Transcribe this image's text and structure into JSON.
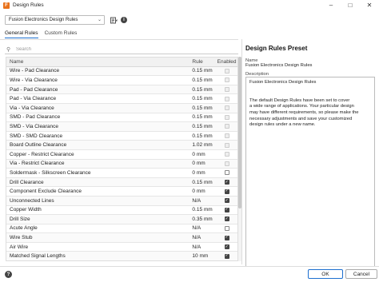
{
  "window": {
    "title": "Design Rules",
    "app_icon": "fusion-app-icon",
    "controls": [
      "minimize",
      "maximize",
      "close"
    ]
  },
  "toolbar": {
    "preset_selected": "Fusion Electronics Design Rules",
    "icons": [
      "preset-manage-icon",
      "info-icon"
    ]
  },
  "tabs": [
    {
      "label": "General Rules",
      "active": true
    },
    {
      "label": "Custom Rules",
      "active": false
    }
  ],
  "search": {
    "placeholder": "Search",
    "value": ""
  },
  "table": {
    "headers": {
      "name": "Name",
      "rule": "Rule",
      "enabled": "Enabled"
    },
    "rows": [
      {
        "name": "Wire - Pad Clearance",
        "rule": "0.15 mm",
        "enabled": "disabled"
      },
      {
        "name": "Wire - Via Clearance",
        "rule": "0.15 mm",
        "enabled": "disabled"
      },
      {
        "name": "Pad - Pad Clearance",
        "rule": "0.15 mm",
        "enabled": "disabled"
      },
      {
        "name": "Pad - Via Clearance",
        "rule": "0.15 mm",
        "enabled": "disabled"
      },
      {
        "name": "Via - Via Clearance",
        "rule": "0.15 mm",
        "enabled": "disabled"
      },
      {
        "name": "SMD - Pad Clearance",
        "rule": "0.15 mm",
        "enabled": "disabled"
      },
      {
        "name": "SMD - Via Clearance",
        "rule": "0.15 mm",
        "enabled": "disabled"
      },
      {
        "name": "SMD - SMD Clearance",
        "rule": "0.15 mm",
        "enabled": "disabled"
      },
      {
        "name": "Board Outline Clearance",
        "rule": "1.02 mm",
        "enabled": "disabled"
      },
      {
        "name": "Copper - Restrict Clearance",
        "rule": "0 mm",
        "enabled": "disabled"
      },
      {
        "name": "Via - Restrict Clearance",
        "rule": "0 mm",
        "enabled": "disabled"
      },
      {
        "name": "Soldermask - Silkscreen Clearance",
        "rule": "0 mm",
        "enabled": "unchecked"
      },
      {
        "name": "Drill Clearance",
        "rule": "0.15 mm",
        "enabled": "checked"
      },
      {
        "name": "Component Exclude Clearance",
        "rule": "0 mm",
        "enabled": "checked"
      },
      {
        "name": "Unconnected Lines",
        "rule": "N/A",
        "enabled": "checked"
      },
      {
        "name": "Copper Width",
        "rule": "0.15 mm",
        "enabled": "checked"
      },
      {
        "name": "Drill Size",
        "rule": "0.35 mm",
        "enabled": "checked"
      },
      {
        "name": "Acute Angle",
        "rule": "N/A",
        "enabled": "unchecked"
      },
      {
        "name": "Wire Stub",
        "rule": "N/A",
        "enabled": "checked"
      },
      {
        "name": "Air Wire",
        "rule": "N/A",
        "enabled": "checked"
      },
      {
        "name": "Matched Signal Lengths",
        "rule": "10 mm",
        "enabled": "checked"
      }
    ]
  },
  "preset_panel": {
    "heading": "Design Rules Preset",
    "name_label": "Name",
    "name_value": "Fusion Electronics Design Rules",
    "description_label": "Description",
    "description_text": "Fusion Electronics Design Rules\n\n\nThe default Design Rules have been set to cover\na wide range of applications. Your particular design\nmay have different requirements, so please make the\nnecessary adjustments and save your customized\ndesign rules under a new name."
  },
  "footer": {
    "help_icon": "help-icon",
    "ok_label": "OK",
    "cancel_label": "Cancel"
  }
}
